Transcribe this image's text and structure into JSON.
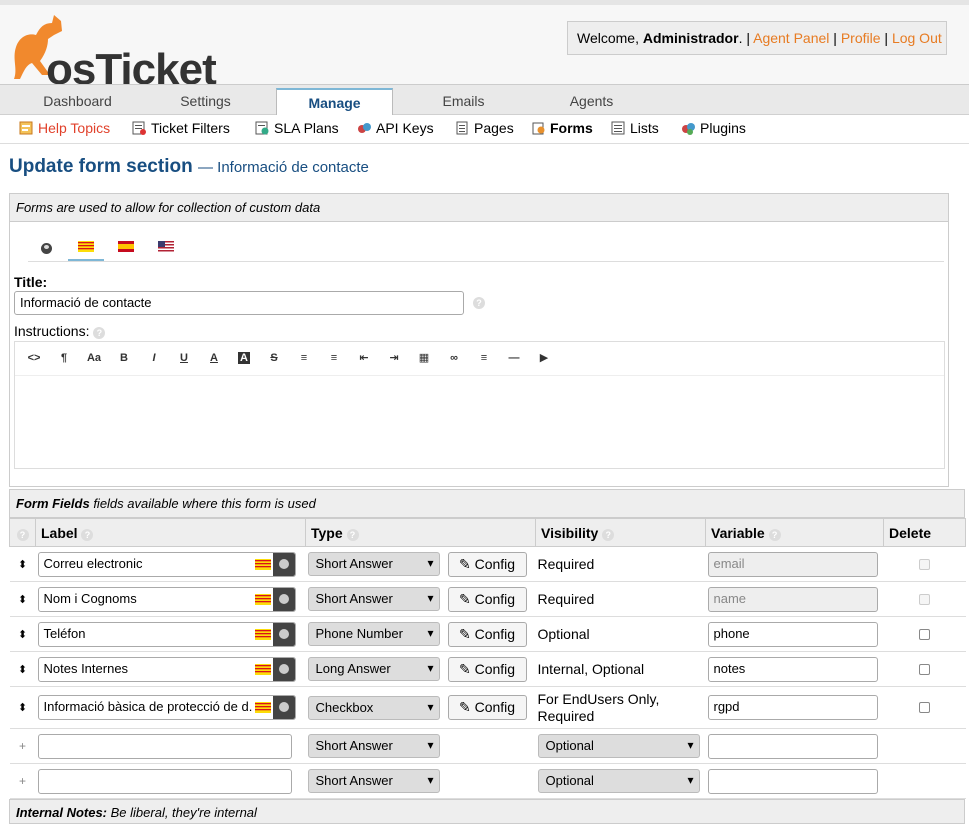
{
  "header": {
    "logo_text": "osTicket",
    "welcome_prefix": "Welcome,",
    "username": "Administrador",
    "links": [
      "Agent Panel",
      "Profile",
      "Log Out"
    ]
  },
  "nav": {
    "tabs": [
      "Dashboard",
      "Settings",
      "Manage",
      "Emails",
      "Agents"
    ],
    "active": "Manage"
  },
  "subnav": [
    {
      "label": "Help Topics",
      "icon": "help-topics-icon"
    },
    {
      "label": "Ticket Filters",
      "icon": "ticket-filters-icon"
    },
    {
      "label": "SLA Plans",
      "icon": "sla-plans-icon"
    },
    {
      "label": "API Keys",
      "icon": "api-keys-icon"
    },
    {
      "label": "Pages",
      "icon": "pages-icon"
    },
    {
      "label": "Forms",
      "icon": "forms-icon"
    },
    {
      "label": "Lists",
      "icon": "lists-icon"
    },
    {
      "label": "Plugins",
      "icon": "plugins-icon"
    }
  ],
  "page": {
    "title": "Update form section",
    "subtitle": "— Informació de contacte"
  },
  "form": {
    "intro": "Forms are used to allow for collection of custom data",
    "title_label": "Title:",
    "title_value": "Informació de contacte",
    "instructions_label": "Instructions:",
    "toolbar": [
      "<>",
      "¶",
      "Aa",
      "B",
      "I",
      "U",
      "A",
      "A",
      "S",
      "≡",
      "≡",
      "⇤",
      "⇥",
      "▦",
      "∞",
      "≡",
      "—",
      "▶"
    ]
  },
  "fields": {
    "header_bold": "Form Fields",
    "header_text": "fields available where this form is used",
    "columns": [
      "Label",
      "Type",
      "Visibility",
      "Variable",
      "Delete"
    ],
    "config_label": "Config",
    "rows": [
      {
        "label": "Correu electronic",
        "type": "Short Answer",
        "visibility": "Required",
        "variable": "email"
      },
      {
        "label": "Nom i Cognoms",
        "type": "Short Answer",
        "visibility": "Required",
        "variable": "name"
      },
      {
        "label": "Teléfon",
        "type": "Phone Number",
        "visibility": "Optional",
        "variable": "phone"
      },
      {
        "label": "Notes Internes",
        "type": "Long Answer",
        "visibility": "Internal, Optional",
        "variable": "notes"
      },
      {
        "label": "Informació bàsica de protecció de d.",
        "type": "Checkbox",
        "visibility": "For EndUsers Only, Required",
        "variable": "rgpd"
      }
    ],
    "new_rows": [
      {
        "type": "Short Answer",
        "visibility": "Optional"
      },
      {
        "type": "Short Answer",
        "visibility": "Optional"
      }
    ]
  },
  "notes": {
    "bold": "Internal Notes:",
    "text": "Be liberal, they're internal"
  }
}
